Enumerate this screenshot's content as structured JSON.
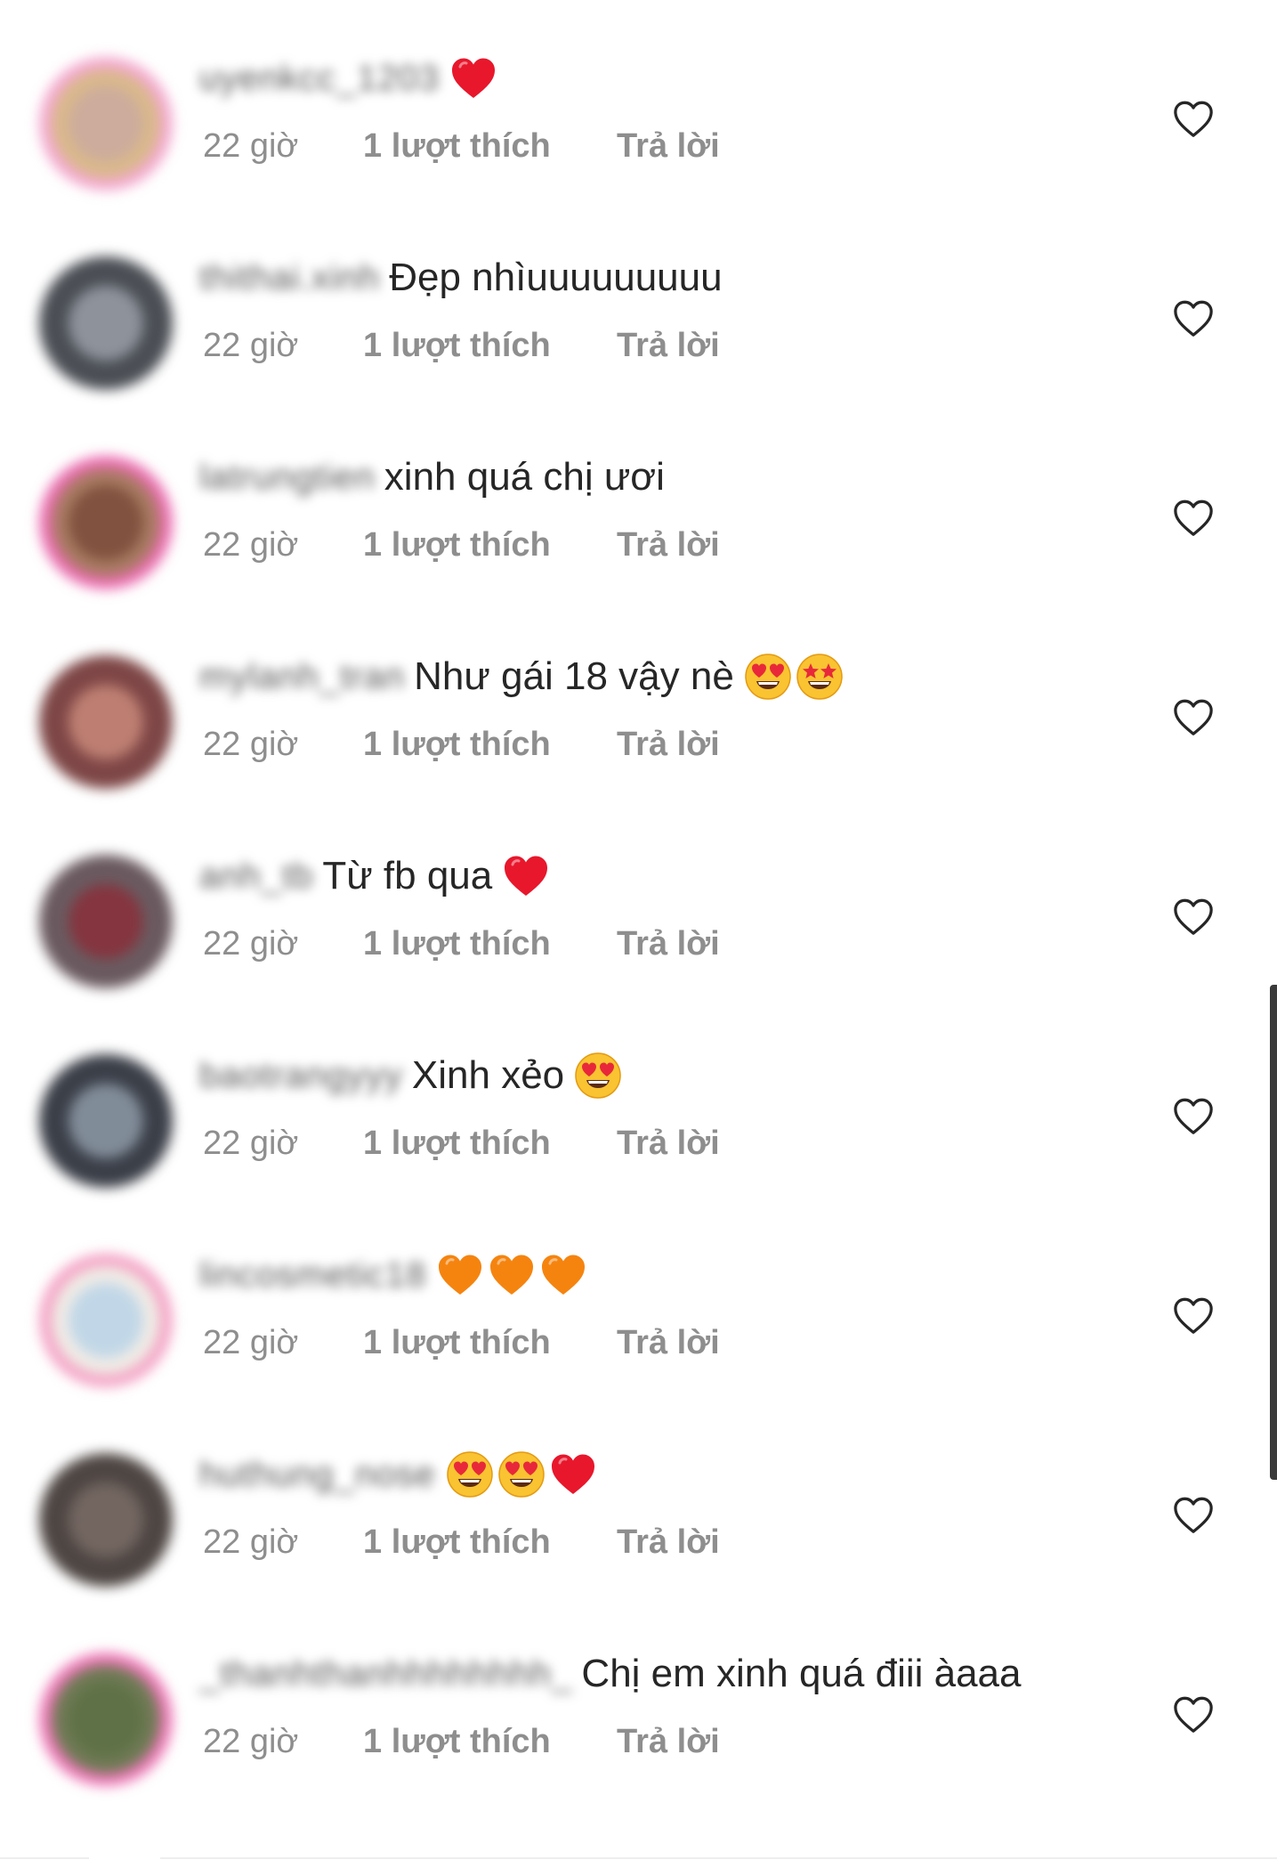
{
  "comments": [
    {
      "username": "uyenkcc_1203",
      "text": "",
      "time": "22 giờ",
      "likes": "1 lượt thích",
      "reply": "Trả lời",
      "emojis": [
        "red-heart"
      ],
      "avatar": {
        "color": "#d9b98a",
        "ring": "#f3a9cf",
        "inner": "#caa9a0"
      }
    },
    {
      "username": "thithai.xinh",
      "text": "Đẹp nhìuuuuuuuuu",
      "time": "22 giờ",
      "likes": "1 lượt thích",
      "reply": "Trả lời",
      "emojis": [],
      "avatar": {
        "color": "#4b4f55",
        "ring": "#4b4f55",
        "inner": "#9a9ea8"
      }
    },
    {
      "username": "latrungtien",
      "text": "xinh quá chị ươi",
      "time": "22 giờ",
      "likes": "1 lượt thích",
      "reply": "Trả lời",
      "emojis": [],
      "avatar": {
        "color": "#a87a62",
        "ring": "#ec6fb3",
        "inner": "#7a4b3a"
      }
    },
    {
      "username": "mylanh_tran",
      "text": "Như gái 18 vậy nè",
      "time": "22 giờ",
      "likes": "1 lượt thích",
      "reply": "Trả lời",
      "emojis": [
        "heart-eyes",
        "star-struck"
      ],
      "avatar": {
        "color": "#7e4646",
        "ring": "#7e4646",
        "inner": "#c98a7a"
      }
    },
    {
      "username": "anh_tb",
      "text": "Từ fb qua",
      "time": "22 giờ",
      "likes": "1 lượt thích",
      "reply": "Trả lời",
      "emojis": [
        "red-heart"
      ],
      "avatar": {
        "color": "#6a5a60",
        "ring": "#6a5a60",
        "inner": "#8a2f3a"
      }
    },
    {
      "username": "baotrangyyy",
      "text": "Xinh xẻo",
      "time": "22 giờ",
      "likes": "1 lượt thích",
      "reply": "Trả lời",
      "emojis": [
        "heart-eyes"
      ],
      "avatar": {
        "color": "#3b3f48",
        "ring": "#3b3f48",
        "inner": "#8e9aa8"
      }
    },
    {
      "username": "lincosmetic18",
      "text": "",
      "time": "22 giờ",
      "likes": "1 lượt thích",
      "reply": "Trả lời",
      "emojis": [
        "orange-heart",
        "orange-heart",
        "orange-heart"
      ],
      "avatar": {
        "color": "#f0ece6",
        "ring": "#f4a2c4",
        "inner": "#b9d3e6"
      }
    },
    {
      "username": "huthung_nose",
      "text": "",
      "time": "22 giờ",
      "likes": "1 lượt thích",
      "reply": "Trả lời",
      "emojis": [
        "heart-eyes",
        "heart-eyes",
        "red-heart"
      ],
      "avatar": {
        "color": "#4e4643",
        "ring": "#4e4643",
        "inner": "#7a6c66"
      }
    },
    {
      "username": "_thanhthanhhhhhhhh_",
      "text": "Chị em xinh quá điii àaaa",
      "time": "22 giờ",
      "likes": "1 lượt thích",
      "reply": "Trả lời",
      "emojis": [],
      "avatar": {
        "color": "#6f7a55",
        "ring": "#ef79b8",
        "inner": "#5d7044"
      }
    }
  ],
  "colors": {
    "text": "#262626",
    "meta": "#8e8e8e",
    "heart_outline": "#262626"
  },
  "icons": {
    "like_button": "heart-outline-icon"
  }
}
